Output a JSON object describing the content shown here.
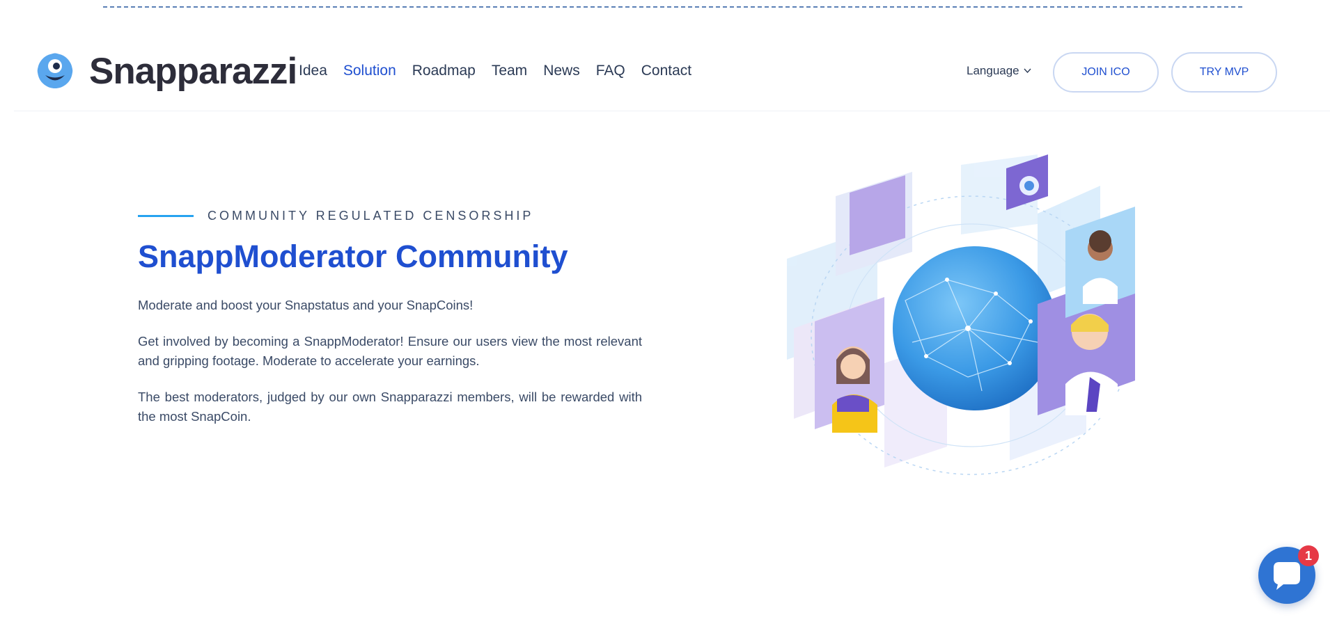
{
  "brand": {
    "name": "Snapparazzi"
  },
  "nav": {
    "items": [
      {
        "label": "Idea",
        "active": false
      },
      {
        "label": "Solution",
        "active": true
      },
      {
        "label": "Roadmap",
        "active": false
      },
      {
        "label": "Team",
        "active": false
      },
      {
        "label": "News",
        "active": false
      },
      {
        "label": "FAQ",
        "active": false
      },
      {
        "label": "Contact",
        "active": false
      }
    ],
    "language_label": "Language",
    "join_label": "JOIN ICO",
    "try_label": "TRY MVP"
  },
  "hero": {
    "eyebrow": "COMMUNITY REGULATED CENSORSHIP",
    "title": "SnappModerator Community",
    "paragraphs": [
      "Moderate and boost your Snapstatus and your SnapCoins!",
      "Get involved by becoming a SnappModerator! Ensure our users view the most relevant and gripping footage. Moderate to accelerate your earnings.",
      "The best moderators, judged by our own Snapparazzi members, will be rewarded with the most SnapCoin."
    ]
  },
  "chat": {
    "badge_count": "1"
  },
  "colors": {
    "accent": "#1f4fd0",
    "eyebrow_line": "#27a3f0",
    "chat_bg": "#2f74d3",
    "badge": "#e63946"
  }
}
